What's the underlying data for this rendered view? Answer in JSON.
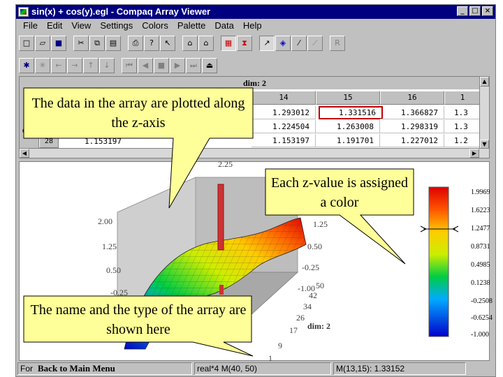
{
  "window": {
    "title": "sin(x) + cos(y).egl - Compaq Array Viewer",
    "buttons": {
      "minimize": "_",
      "maximize": "□",
      "close": "×"
    }
  },
  "menu": [
    "File",
    "Edit",
    "View",
    "Settings",
    "Colors",
    "Palette",
    "Data",
    "Help"
  ],
  "toolbar1": {
    "icons": [
      "new-icon",
      "open-icon",
      "save-icon",
      "cut-icon",
      "copy-icon",
      "paste-icon",
      "print-icon",
      "help-icon",
      "context-help-icon",
      "home-icon",
      "house-icon",
      "color-palette-icon",
      "hourglass-icon",
      "cursor-icon",
      "flag-icon",
      "wand-icon",
      "chart-icon"
    ],
    "r_label": "R"
  },
  "toolbar2": {
    "icons": [
      "shrink-icon",
      "expand-icon",
      "arrow-left-icon",
      "arrow-right-icon",
      "arrow-up-icon",
      "arrow-down-icon",
      "first-icon",
      "previous-icon",
      "stop-icon",
      "next-icon",
      "last-icon",
      "eject-icon"
    ]
  },
  "grid": {
    "dim_label": "dim: 2",
    "columns": [
      "14",
      "15",
      "16",
      "1"
    ],
    "rows": [
      [
        "1.293012",
        "1.331516",
        "1.366827",
        "1.3"
      ],
      [
        "1.224504",
        "1.263008",
        "1.298319",
        "1.3"
      ],
      [
        "1.153197",
        "1.191701",
        "1.227012",
        "1.2"
      ]
    ],
    "row_header_partial": "28",
    "side_label": "dim",
    "left_cell_partial": "1.153197"
  },
  "plot": {
    "z_ticks": [
      "2.00",
      "1.25",
      "0.50",
      "-0.25"
    ],
    "right_ticks": [
      "1.25",
      "0.50",
      "-0.25",
      "-1.00"
    ],
    "extra_tick": "50",
    "dim2_ticks": [
      "42",
      "34",
      "26",
      "17",
      "9",
      "1"
    ],
    "dim2_label": "dim: 2",
    "top_label": "2.25",
    "colorbar_labels": [
      "1.9969",
      "1.6223",
      "1.2477",
      "0.8731",
      "0.4985",
      "0.1238",
      "-0.2508",
      "-0.6254",
      "-1.000"
    ]
  },
  "colors": {
    "titlebar": "#000080",
    "chrome": "#c0c0c0",
    "callout_fill": "#ffff99",
    "selection": "#c00000"
  },
  "status": {
    "left": "For",
    "array_type": "real*4 M(40, 50)",
    "element": "M(13,15): 1.33152"
  },
  "back_link": "Back to Main Menu",
  "callouts": {
    "z_axis": "The data in the array are plotted along the z-axis",
    "color": "Each z-value is assigned a color",
    "name_type": "The name and the type of the array are shown here"
  }
}
